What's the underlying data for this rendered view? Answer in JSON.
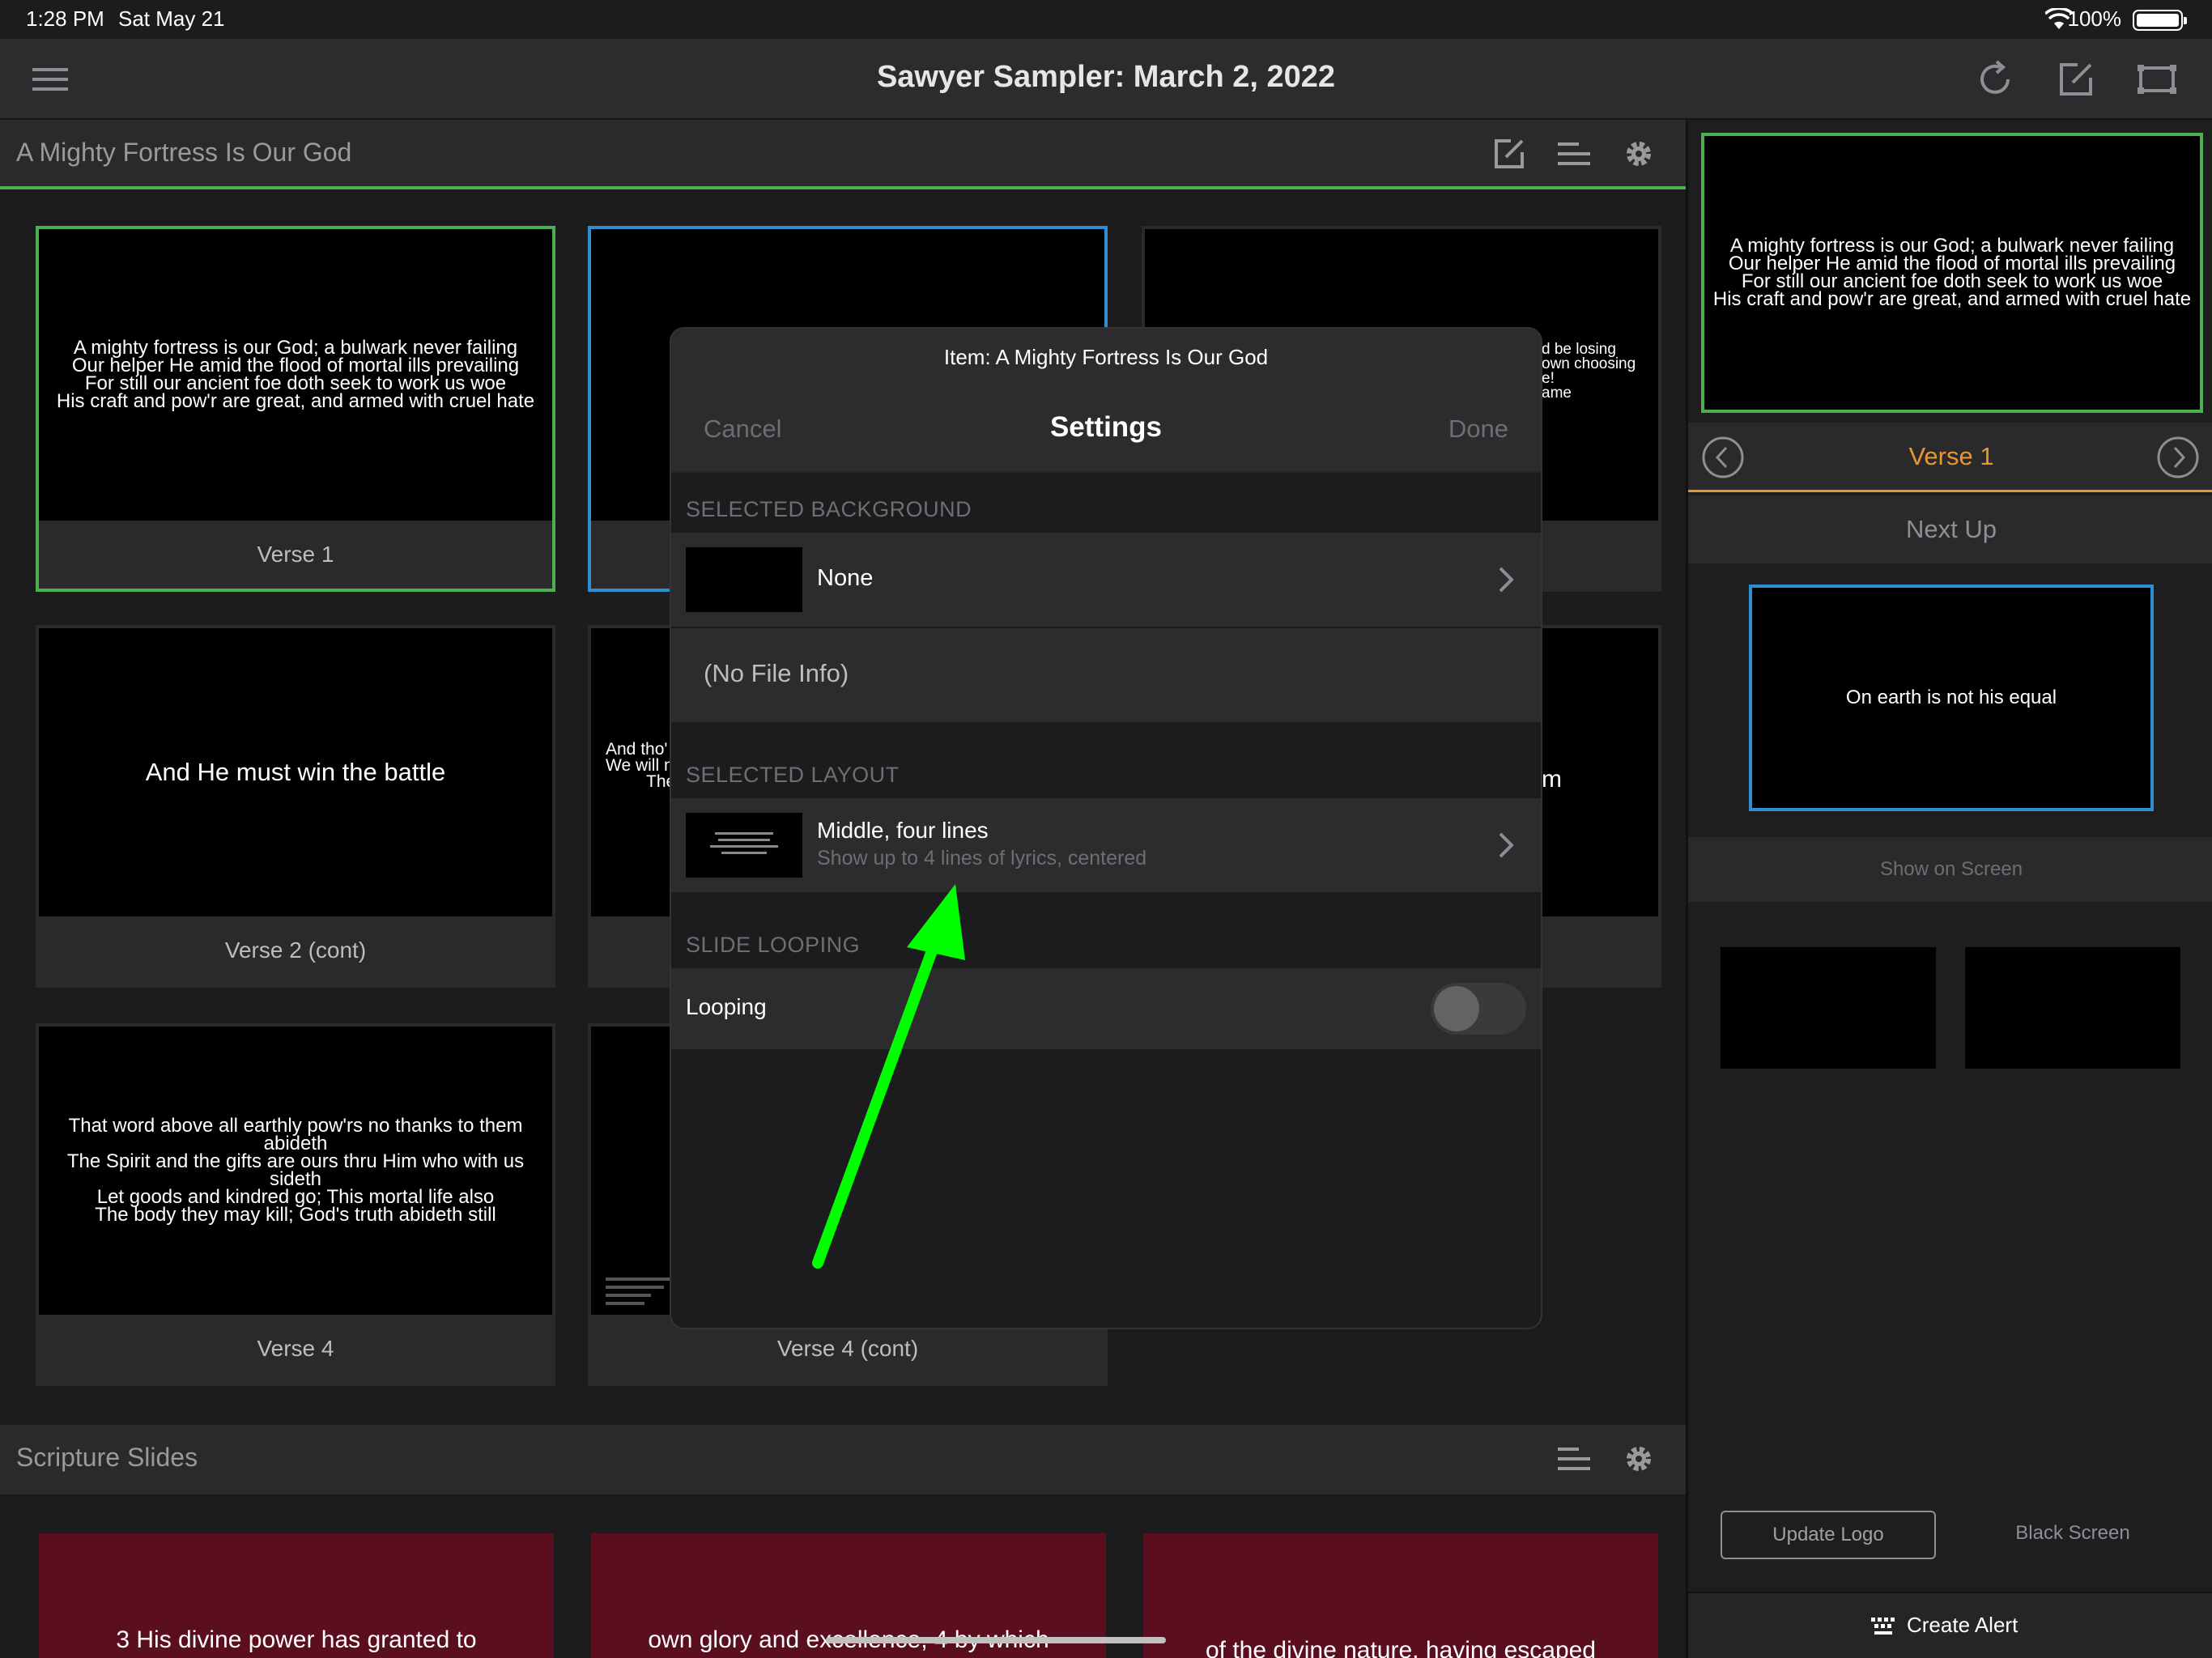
{
  "status_bar": {
    "time": "1:28 PM",
    "date": "Sat May 21",
    "battery": "100%"
  },
  "topnav": {
    "title": "Sawyer Sampler: March 2, 2022"
  },
  "song_section": {
    "title": "A Mighty Fortress Is Our God"
  },
  "slides": [
    {
      "label": "Verse 1",
      "lyrics": [
        "A mighty fortress is our God; a bulwark never failing",
        "Our helper He amid the flood of mortal ills prevailing",
        "For still our ancient foe doth seek to work us woe",
        "His craft and pow'r are great, and armed with cruel hate"
      ]
    },
    {
      "label": "",
      "lyrics": []
    },
    {
      "label": "",
      "lyrics": [
        "d be losing",
        "own choosing",
        "e!",
        "ame"
      ]
    },
    {
      "label": "Verse 2 (cont)",
      "lyrics": [
        "And He must win the battle"
      ]
    },
    {
      "label": "",
      "lyrics": [
        "And tho'",
        "We will n",
        "The",
        "H"
      ]
    },
    {
      "label": "",
      "lyrics": [
        "m"
      ]
    },
    {
      "label": "Verse 4",
      "lyrics": [
        "That word above all earthly pow'rs no thanks to them abideth",
        "The Spirit and the gifts are ours thru Him who with us sideth",
        "Let goods and kindred go; This mortal life also",
        "The body they may kill; God's truth abideth still"
      ]
    },
    {
      "label": "Verse 4 (cont)",
      "lyrics": []
    }
  ],
  "scripture_section": {
    "title": "Scripture Slides"
  },
  "scripture_slides": [
    {
      "text": "3 His divine power has granted to"
    },
    {
      "text": "own glory and excellence, 4 by which"
    },
    {
      "text": "of the divine nature, having escaped"
    }
  ],
  "right_panel": {
    "preview_lyrics": [
      "A mighty fortress is our God; a bulwark never failing",
      "Our helper He amid the flood of mortal ills prevailing",
      "For still our ancient foe doth seek to work us woe",
      "His craft and pow'r are great, and armed with cruel hate"
    ],
    "current_label": "Verse 1",
    "next_up_label": "Next Up",
    "next_up_lyrics": "On earth is not his equal",
    "show_on_screen": "Show on Screen",
    "update_logo": "Update Logo",
    "black_screen": "Black Screen",
    "create_alert": "Create Alert"
  },
  "modal": {
    "item_title": "Item: A Mighty Fortress Is Our God",
    "cancel": "Cancel",
    "title": "Settings",
    "done": "Done",
    "background_header": "SELECTED BACKGROUND",
    "background_value": "None",
    "file_info": "(No File Info)",
    "layout_header": "SELECTED LAYOUT",
    "layout_name": "Middle, four lines",
    "layout_desc": "Show up to 4 lines of lyrics, centered",
    "looping_header": "SLIDE LOOPING",
    "looping_label": "Looping",
    "looping_on": false
  },
  "annotation": {
    "arrow_color": "#00ff00"
  },
  "colors": {
    "accent_green": "#4caf50",
    "accent_blue": "#2e8fcf",
    "accent_orange": "#e8962e"
  }
}
